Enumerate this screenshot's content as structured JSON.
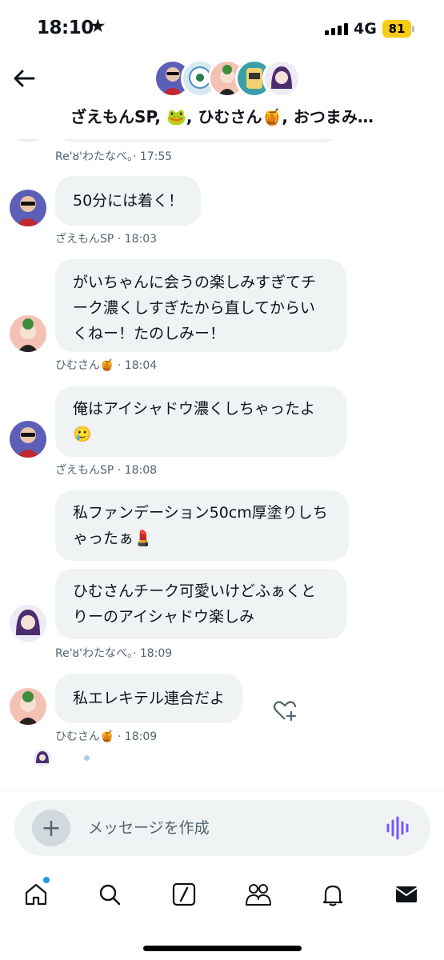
{
  "status_bar": {
    "time": "18:10",
    "star": "★",
    "network": "4G",
    "battery": "81"
  },
  "header": {
    "title": "ざえもんSP, 🐸, ひむさん🍯, おつまみ…"
  },
  "messages": [
    {
      "meta": "Re'ȣ'わたなべ。· 17:55"
    },
    {
      "text": "50分には着く！",
      "meta": "ざえもんSP · 18:03"
    },
    {
      "text": "がいちゃんに会うの楽しみすぎてチーク濃くしすぎたから直してからいくねー！たのしみー！",
      "meta": "ひむさん🍯 · 18:04"
    },
    {
      "text": "俺はアイシャドウ濃くしちゃったよ🥲",
      "meta": "ざえもんSP · 18:08"
    },
    {
      "text": "私ファンデーション50cm厚塗りしちゃったぁ💄"
    },
    {
      "text": "ひむさんチーク可愛いけどふぁくとりーのアイシャドウ楽しみ",
      "meta": "Re'ȣ'わたなべ。· 18:09"
    },
    {
      "text": "私エレキテル連合だよ",
      "meta": "ひむさん🍯 · 18:09"
    }
  ],
  "composer": {
    "placeholder": "メッセージを作成",
    "plus": "+"
  },
  "icons": {
    "back": "arrow-left-icon",
    "add_reaction": "heart-plus-icon",
    "voice": "voice-waveform-icon",
    "nav": [
      "home-icon",
      "search-icon",
      "grok-icon",
      "communities-icon",
      "bell-icon",
      "mail-icon"
    ]
  },
  "colors": {
    "bubble": "#eff3f4",
    "meta": "#536471",
    "accent": "#1d9bf0",
    "battery": "#f6cc15",
    "voice": "#7856ff"
  }
}
